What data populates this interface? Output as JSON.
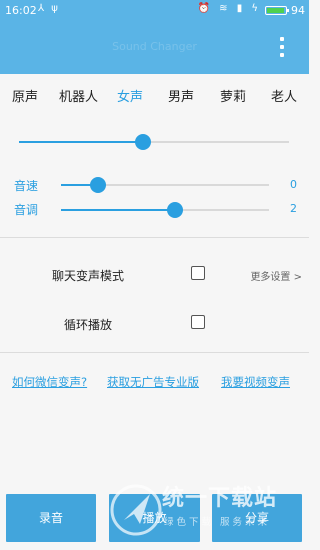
{
  "status_bar": {
    "time": "16:02",
    "left_icons": [
      "usb-debug-icon",
      "usb-icon"
    ],
    "right_icons": [
      "alarm-icon",
      "wifi-icon",
      "signal-icon",
      "charging-icon"
    ],
    "battery_level_percent": 94,
    "battery_text": "94",
    "background_color": "#5ab4e6"
  },
  "toolbar": {
    "title": "Sound Changer",
    "menu_icon": "more-vert-icon",
    "background_color": "#5ab4e6"
  },
  "voice_tabs": {
    "items": [
      "原声",
      "机器人",
      "女声",
      "男声",
      "萝莉",
      "老人"
    ],
    "selected": "女声",
    "accent_color": "#2a9fe0"
  },
  "main_slider": {
    "value_fraction": 0.46
  },
  "params": {
    "speed": {
      "label": "音速",
      "value": "0",
      "value_fraction": 0.18
    },
    "pitch": {
      "label": "音调",
      "value": "2",
      "value_fraction": 0.55
    }
  },
  "options": {
    "chat_mode": {
      "label": "聊天变声模式",
      "checked": false
    },
    "loop_play": {
      "label": "循环播放",
      "checked": false
    },
    "more_settings": "更多设置 >"
  },
  "links": [
    "如何微信变声?",
    "获取无广告专业版",
    "我要视频变声"
  ],
  "buttons": {
    "record": "录音",
    "play": "播放",
    "share": "分享"
  },
  "watermark": {
    "text": "统一下载站",
    "subtitle": "绿色下载 服务未来"
  }
}
